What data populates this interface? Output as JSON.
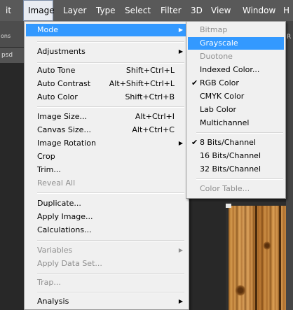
{
  "menubar": {
    "items": [
      "it",
      "Image",
      "Layer",
      "Type",
      "Select",
      "Filter",
      "3D",
      "View",
      "Window",
      "H"
    ]
  },
  "background": {
    "options_fragment": "ons",
    "tab_fragment": "psd",
    "right_fragment": "R"
  },
  "image_menu": {
    "mode": "Mode",
    "adjustments": "Adjustments",
    "auto_tone": "Auto Tone",
    "auto_tone_sc": "Shift+Ctrl+L",
    "auto_contrast": "Auto Contrast",
    "auto_contrast_sc": "Alt+Shift+Ctrl+L",
    "auto_color": "Auto Color",
    "auto_color_sc": "Shift+Ctrl+B",
    "image_size": "Image Size...",
    "image_size_sc": "Alt+Ctrl+I",
    "canvas_size": "Canvas Size...",
    "canvas_size_sc": "Alt+Ctrl+C",
    "image_rotation": "Image Rotation",
    "crop": "Crop",
    "trim": "Trim...",
    "reveal_all": "Reveal All",
    "duplicate": "Duplicate...",
    "apply_image": "Apply Image...",
    "calculations": "Calculations...",
    "variables": "Variables",
    "apply_data_set": "Apply Data Set...",
    "trap": "Trap...",
    "analysis": "Analysis"
  },
  "mode_submenu": {
    "bitmap": "Bitmap",
    "grayscale": "Grayscale",
    "duotone": "Duotone",
    "indexed_color": "Indexed Color...",
    "rgb_color": "RGB Color",
    "cmyk_color": "CMYK Color",
    "lab_color": "Lab Color",
    "multichannel": "Multichannel",
    "bits8": "8 Bits/Channel",
    "bits16": "16 Bits/Channel",
    "bits32": "32 Bits/Channel",
    "color_table": "Color Table...",
    "checkmark": "✔"
  },
  "colors": {
    "highlight": "#3399ff",
    "menubar": "#595959",
    "disabled_text": "#8e8e8e"
  }
}
